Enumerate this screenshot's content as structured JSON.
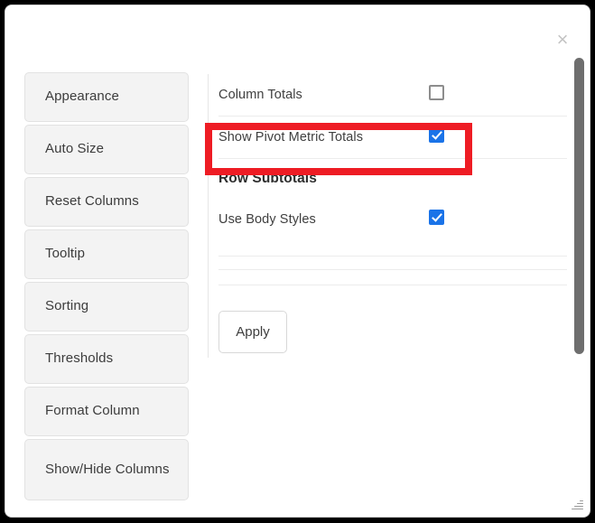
{
  "dialog": {
    "close_icon": "×",
    "resize_grip_icon": "resize-grip"
  },
  "sidebar": {
    "items": [
      {
        "label": "Appearance"
      },
      {
        "label": "Auto Size"
      },
      {
        "label": "Reset Columns"
      },
      {
        "label": "Tooltip"
      },
      {
        "label": "Sorting"
      },
      {
        "label": "Thresholds"
      },
      {
        "label": "Format Column"
      },
      {
        "label": "Show/Hide Columns"
      }
    ]
  },
  "panel": {
    "options": [
      {
        "label": "Column Totals",
        "checked": false
      },
      {
        "label": "Show Pivot Metric Totals",
        "checked": true
      }
    ],
    "section_title": "Row Subtotals",
    "section_options": [
      {
        "label": "Use Body Styles",
        "checked": true
      }
    ],
    "apply_label": "Apply"
  },
  "highlight": {
    "color": "#ee1c24",
    "target": "Show Pivot Metric Totals"
  },
  "colors": {
    "checkbox_checked": "#1a73e8",
    "sidebar_button_bg": "#f3f3f3",
    "scrollbar_thumb": "#6e6e6e"
  }
}
